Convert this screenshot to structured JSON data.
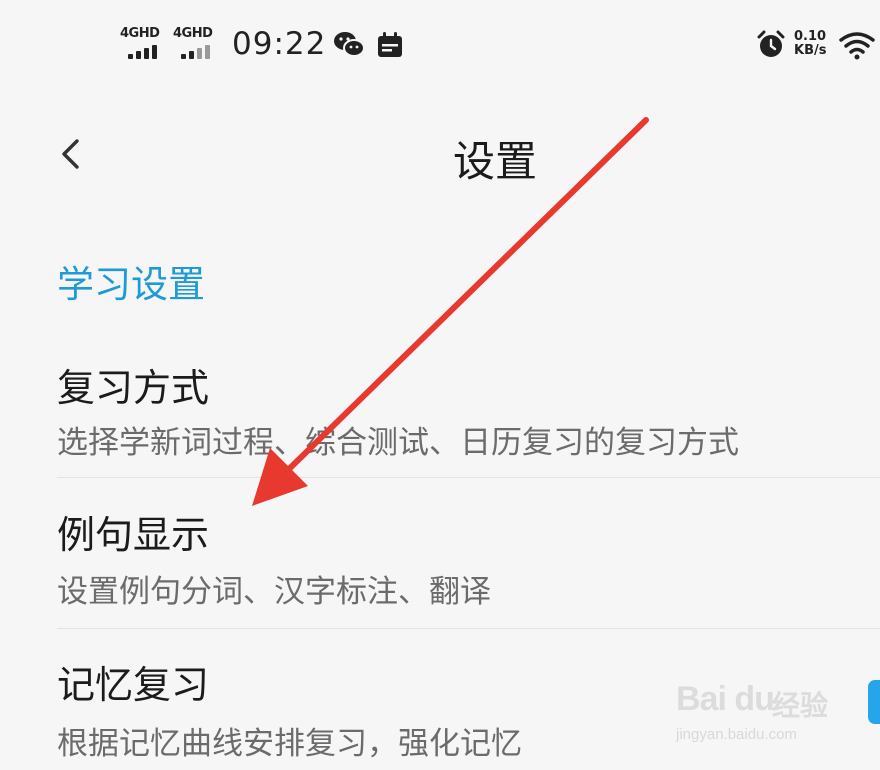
{
  "status_bar": {
    "signal_1_label": "4GHD",
    "signal_2_label": "4GHD",
    "time": "09:22",
    "net_speed_value": "0.10",
    "net_speed_unit": "KB/s",
    "icons": [
      "wechat-icon",
      "calendar-icon",
      "alarm-icon",
      "wifi-icon"
    ]
  },
  "header": {
    "back_icon": "chevron-left-icon",
    "title": "设置"
  },
  "sections": [
    {
      "header": "学习设置",
      "items": [
        {
          "title": "复习方式",
          "description": "选择学新词过程、综合测试、日历复习的复习方式"
        },
        {
          "title": "例句显示",
          "description": "设置例句分词、汉字标注、翻译"
        },
        {
          "title": "记忆复习",
          "description": "根据记忆曲线安排复习，强化记忆"
        }
      ]
    }
  ],
  "watermark": {
    "brand": "Bai du",
    "brand_cn": "经验",
    "url": "jingyan.baidu.com"
  },
  "colors": {
    "accent": "#1e9ad6",
    "arrow": "#e8392e",
    "background": "#f6f6f6",
    "edge_tab": "#27a5ea"
  }
}
